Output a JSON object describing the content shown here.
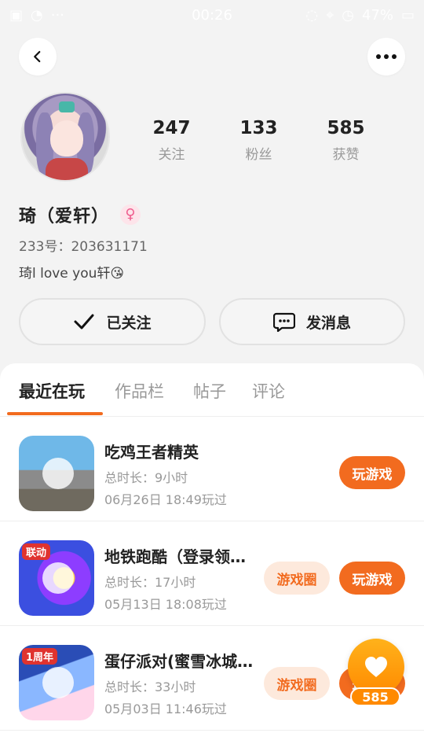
{
  "status_bar": {
    "time": "00:26",
    "battery": "47%"
  },
  "header": {
    "back_icon": "chevron-left-icon",
    "more_icon": "more-horizontal-icon"
  },
  "profile": {
    "stats": [
      {
        "value": "247",
        "label": "关注"
      },
      {
        "value": "133",
        "label": "粉丝"
      },
      {
        "value": "585",
        "label": "获赞"
      }
    ],
    "name": "琦（爱轩）",
    "gender_symbol": "♀",
    "uid": "233号：203631171",
    "bio": "琦l love you轩😘"
  },
  "actions": {
    "follow_label": "已关注",
    "message_label": "发消息"
  },
  "tabs": [
    {
      "label": "最近在玩",
      "active": true
    },
    {
      "label": "作品栏",
      "active": false
    },
    {
      "label": "帖子",
      "active": false
    },
    {
      "label": "评论",
      "active": false
    }
  ],
  "games": [
    {
      "title": "吃鸡王者精英",
      "duration": "总时长：9小时",
      "last_played": "06月26日 18:49玩过",
      "play_label": "玩游戏",
      "circle_label": ""
    },
    {
      "title": "地铁跑酷（登录领…",
      "duration": "总时长：17小时",
      "last_played": "05月13日 18:08玩过",
      "play_label": "玩游戏",
      "circle_label": "游戏圈",
      "badge": "联动"
    },
    {
      "title": "蛋仔派对(蜜雪冰城…",
      "duration": "总时长：33小时",
      "last_played": "05月03日 11:46玩过",
      "play_label": "玩游戏",
      "circle_label": "游戏圈",
      "badge": "1周年"
    }
  ],
  "floating_like": {
    "count": "585"
  }
}
